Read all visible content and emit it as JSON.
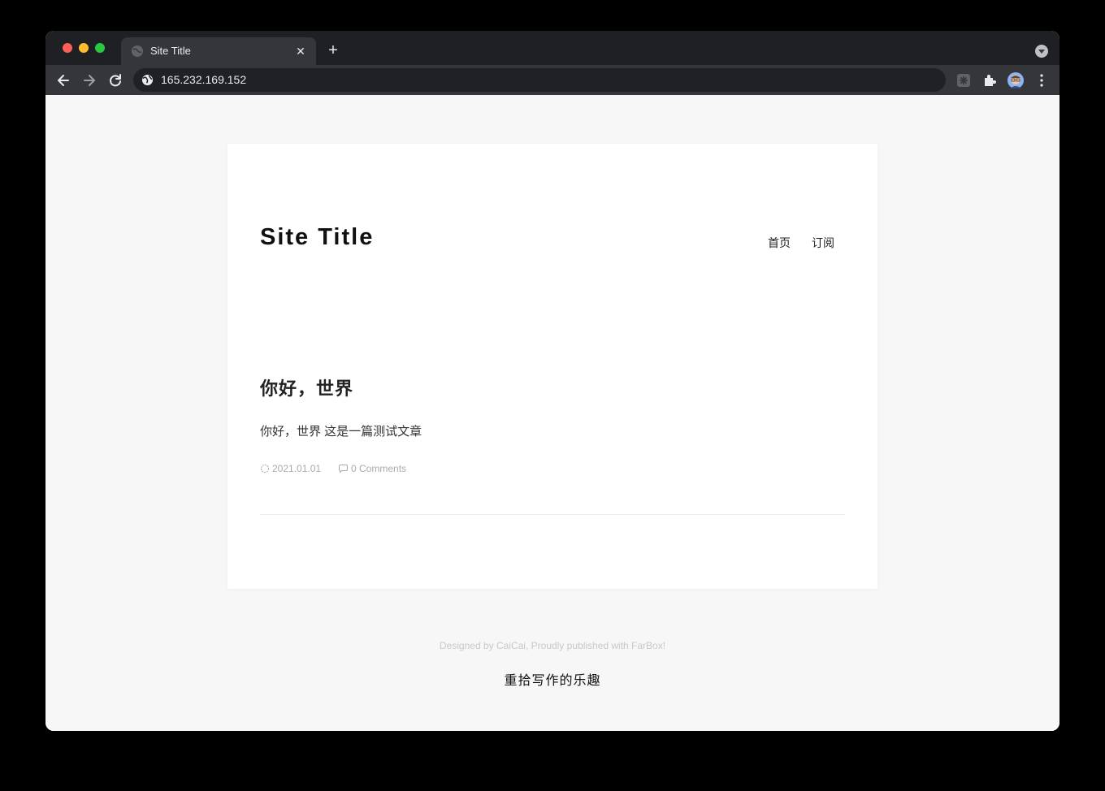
{
  "browser": {
    "tab_title": "Site Title",
    "tab_close": "✕",
    "new_tab": "+",
    "url": "165.232.169.152"
  },
  "site": {
    "title": "Site Title",
    "nav": [
      {
        "label": "首页"
      },
      {
        "label": "订阅"
      }
    ]
  },
  "post": {
    "title": "你好，世界",
    "excerpt": "你好，世界 这是一篇测试文章",
    "date": "2021.01.01",
    "comments": "0 Comments"
  },
  "footer": {
    "credit": "Designed by CaiCai,  Proudly published with FarBox!",
    "slogan": "重拾写作的乐趣"
  },
  "colors": {
    "tabstrip": "#1f2023",
    "toolbar": "#35363a",
    "page_bg": "#f7f7f7",
    "card_bg": "#ffffff"
  },
  "icons": [
    "globe-icon",
    "close-icon",
    "plus-icon",
    "back-icon",
    "forward-icon",
    "reload-icon",
    "extension-icon",
    "puzzle-icon",
    "avatar",
    "menu-icon",
    "clock-icon",
    "comment-icon"
  ]
}
